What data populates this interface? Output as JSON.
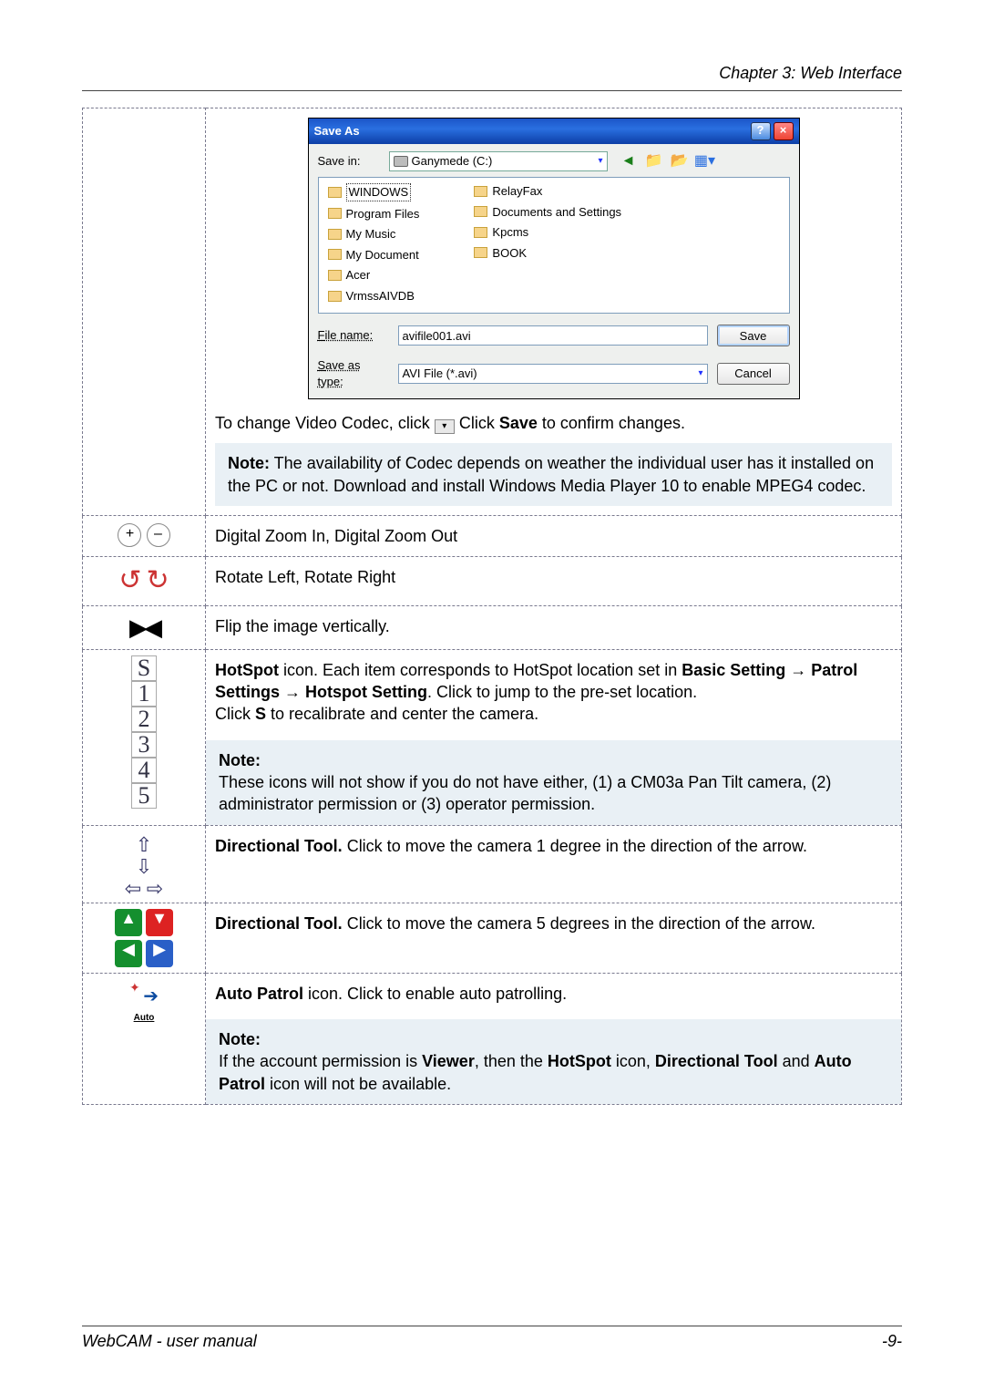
{
  "chapter": "Chapter 3: Web Interface",
  "saveAs": {
    "title": "Save As",
    "saveInLabel": "Save in:",
    "driveName": "Ganymede (C:)",
    "foldersCol1": [
      "WINDOWS",
      "Program Files",
      "My Music",
      "My Document",
      "Acer",
      "VrmssAIVDB"
    ],
    "foldersCol2": [
      "RelayFax",
      "Documents and Settings",
      "Kpcms",
      "BOOK"
    ],
    "fileNameLabel": "File name:",
    "fileNameValue": "avifile001.avi",
    "saveAsTypeLabel": "Save as type:",
    "saveAsTypeValue": "AVI File (*.avi)",
    "saveBtn": "Save",
    "cancelBtn": "Cancel"
  },
  "row1": {
    "codecPre": "To change Video Codec, click ",
    "codecPost": "  Click ",
    "saveWord": "Save",
    "codecEnd": " to confirm changes.",
    "noteLabel": "Note:",
    "noteText": "    The availability of Codec depends on weather the individual user has it installed on the PC or not. Download and install Windows Media Player 10 to enable MPEG4 codec."
  },
  "rowZoom": "Digital Zoom In, Digital Zoom Out",
  "rowRotate": "Rotate Left, Rotate Right",
  "rowFlip": "Flip the image vertically.",
  "hotspot": {
    "labels": [
      "S",
      "1",
      "2",
      "3",
      "4",
      "5"
    ],
    "p1_a": "HotSpot",
    "p1_b": " icon.    Each item corresponds to HotSpot location set in ",
    "p1_c": "Basic Setting",
    "arrow": " → ",
    "p1_d": "Patrol Settings",
    "p1_e": "Hotspot Setting",
    "p1_f": ".    Click to jump to the pre-set location.",
    "p2_a": "Click ",
    "p2_b": "S",
    "p2_c": " to recalibrate and center the camera.",
    "noteLabel": "Note:",
    "noteText": "These icons will not show if you do not have either, (1) a CM03a Pan Tilt camera, (2) administrator permission or (3) operator permission."
  },
  "dir1": {
    "label": "Directional Tool.",
    "text": "    Click to move the camera 1 degree in the direction of the arrow."
  },
  "dir5": {
    "label": "Directional Tool.",
    "text": "    Click to move the camera 5 degrees in the direction of the arrow."
  },
  "auto": {
    "label": "Auto Patrol",
    "iconWord": " icon.    ",
    "text": "Click to enable auto patrolling.",
    "autoLabel": "Auto",
    "noteLabel": "Note:",
    "note_a": "If the account permission is ",
    "note_b": "Viewer",
    "note_c": ", then the ",
    "note_d": "HotSpot",
    "note_e": " icon, ",
    "note_f": "Directional Tool",
    "note_g": " and ",
    "note_h": "Auto Patrol",
    "note_i": " icon will not be available."
  },
  "footerLeft": "WebCAM - user manual",
  "footerRight": "-9-"
}
